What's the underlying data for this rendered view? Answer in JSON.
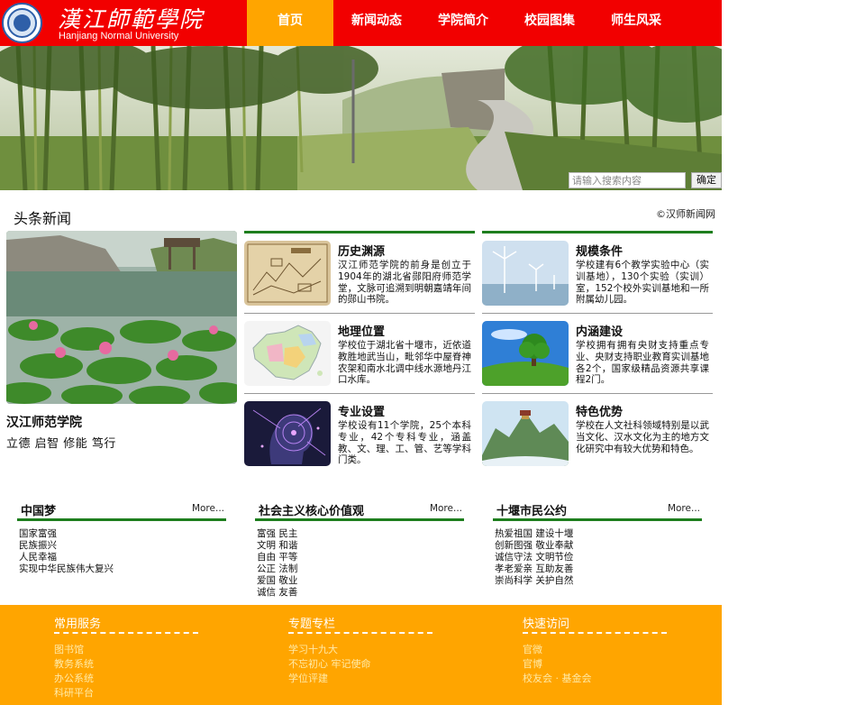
{
  "header": {
    "logo_cn": "漢江師範學院",
    "logo_en": "Hanjiang Normal University",
    "nav": [
      {
        "label": "首页",
        "active": true
      },
      {
        "label": "新闻动态",
        "active": false
      },
      {
        "label": "学院简介",
        "active": false
      },
      {
        "label": "校园图集",
        "active": false
      },
      {
        "label": "师生风采",
        "active": false
      }
    ]
  },
  "search": {
    "placeholder": "请输入搜索内容",
    "button": "确定"
  },
  "headline": {
    "title": "头条新闻",
    "source": "©汉师新闻网",
    "feature": {
      "title": "汉江师范学院",
      "motto": "立德 启智 修能 笃行"
    },
    "cards_left": [
      {
        "title": "历史渊源",
        "text": "汉江师范学院的前身是创立于1904年的湖北省郧阳府师范学堂，文脉可追溯到明朝嘉靖年间的郧山书院。",
        "image": "ancient-map-image"
      },
      {
        "title": "地理位置",
        "text": "学校位于湖北省十堰市，近依道教胜地武当山，毗邻华中屋脊神农架和南水北调中线水源地丹江口水库。",
        "image": "china-map-image"
      },
      {
        "title": "专业设置",
        "text": "学校设有11个学院，25个本科专业，42个专科专业，涵盖教、文、理、工、管、艺等学科门类。",
        "image": "digital-head-image"
      }
    ],
    "cards_right": [
      {
        "title": "规模条件",
        "text": "学校建有6个教学实验中心（实训基地），130个实验（实训）室，152个校外实训基地和一所附属幼儿园。",
        "image": "wind-turbine-image"
      },
      {
        "title": "内涵建设",
        "text": "学校拥有拥有央财支持重点专业、央财支持职业教育实训基地各2个，国家级精品资源共享课程2门。",
        "image": "tree-field-image"
      },
      {
        "title": "特色优势",
        "text": "学校在人文社科领域特别是以武当文化、汉水文化为主的地方文化研究中有较大优势和特色。",
        "image": "mountain-temple-image"
      }
    ]
  },
  "boxes": [
    {
      "title": "中国梦",
      "more": "More...",
      "lines": [
        "国家富强",
        "民族振兴",
        "人民幸福",
        "实现中华民族伟大复兴"
      ]
    },
    {
      "title": "社会主义核心价值观",
      "more": "More...",
      "lines": [
        "富强 民主",
        "文明 和谐",
        "自由 平等",
        "公正 法制",
        "爱国 敬业",
        "诚信 友善"
      ]
    },
    {
      "title": "十堰市民公约",
      "more": "More...",
      "lines": [
        "热爱祖国 建设十堰",
        "创新图强 敬业奉献",
        "诚信守法 文明节俭",
        "孝老爱亲 互助友善",
        "崇尚科学 关护自然"
      ]
    }
  ],
  "footer": {
    "columns": [
      {
        "title": "常用服务",
        "links": [
          "图书馆",
          "教务系统",
          "办公系统",
          "科研平台"
        ]
      },
      {
        "title": "专题专栏",
        "links": [
          "学习十九大",
          "不忘初心 牢记使命",
          "学位评建"
        ]
      },
      {
        "title": "快速访问",
        "links": [
          "官微",
          "官博",
          "校友会 · 基金会"
        ]
      }
    ]
  }
}
